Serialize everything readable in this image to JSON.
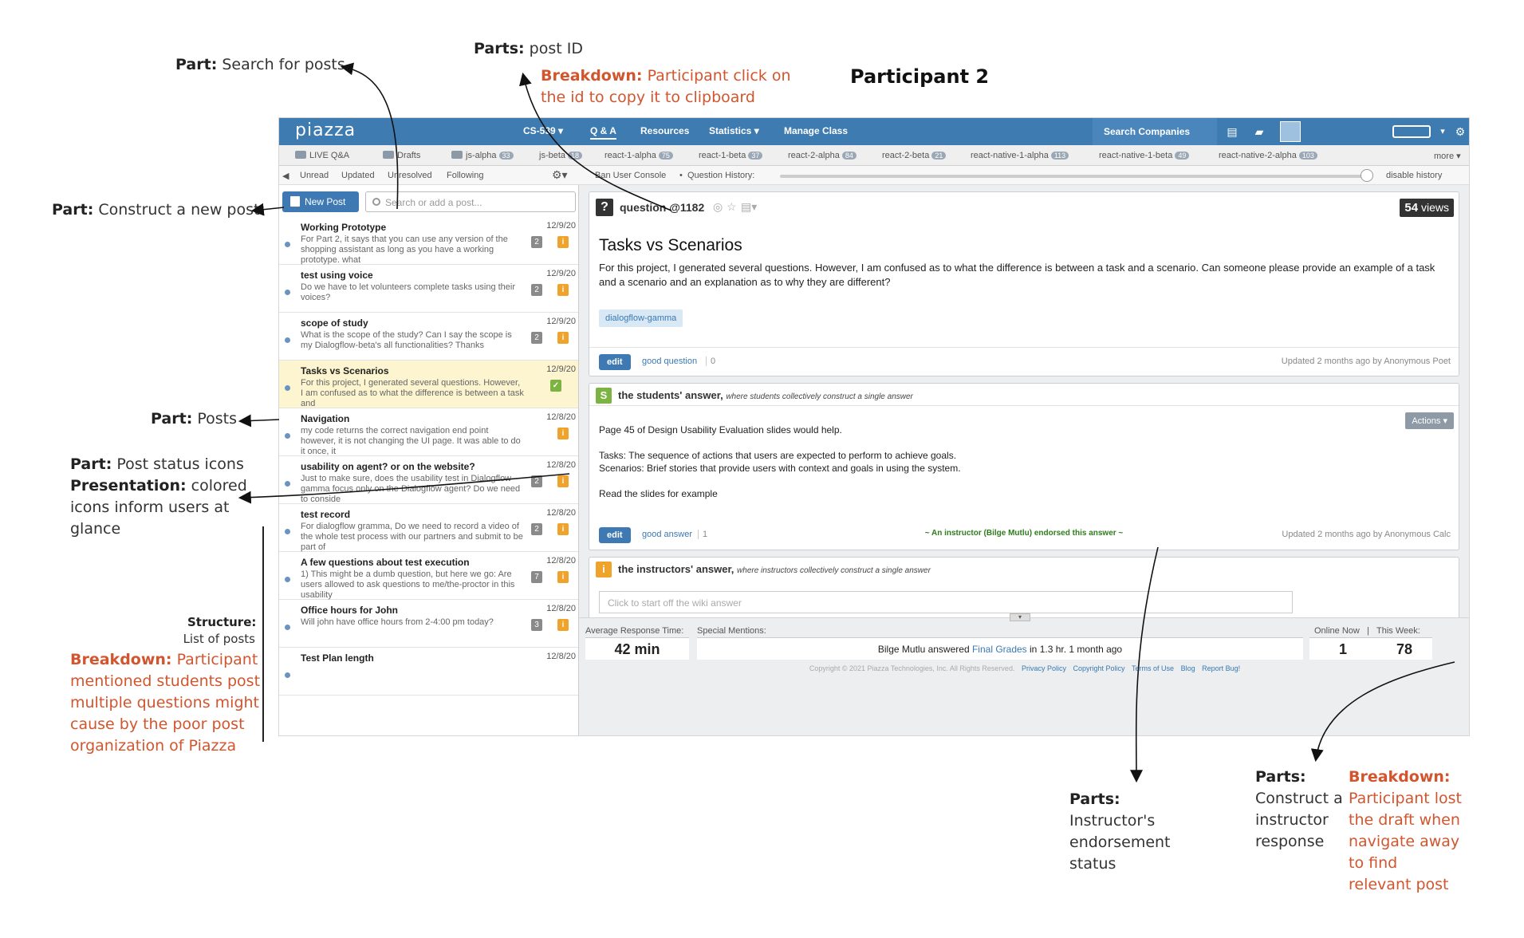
{
  "annotations": {
    "title": "Participant 2",
    "search": {
      "label": "Part:",
      "text": "Search for posts"
    },
    "post_id": {
      "label": "Parts:",
      "text": "post ID"
    },
    "post_id_breakdown": {
      "label": "Breakdown:",
      "text": "Participant click on",
      "text2": "the id to copy it to clipboard"
    },
    "new_post": {
      "label": "Part:",
      "text": "Construct a new post"
    },
    "posts": {
      "label": "Part:",
      "text": "Posts"
    },
    "status_icons": {
      "label": "Part:",
      "text": "Post status icons",
      "label2": "Presentation:",
      "text2": "colored",
      "lines": [
        "icons inform users at",
        "glance"
      ]
    },
    "structure": {
      "label": "Structure:",
      "text": "List of posts"
    },
    "structure_breakdown": {
      "label": "Breakdown:",
      "text": "Participant",
      "lines": [
        "mentioned students post",
        "multiple questions might",
        "cause by the poor post",
        "organization of Piazza"
      ]
    },
    "endorsement": {
      "label": "Parts:",
      "lines": [
        "Instructor's",
        "endorsement",
        "status"
      ]
    },
    "instructor_resp": {
      "label": "Parts:",
      "lines": [
        "Construct a",
        "instructor",
        "response"
      ]
    },
    "draft_breakdown": {
      "label": "Breakdown:",
      "lines": [
        "Participant lost",
        "the draft when",
        "navigate away",
        "to find",
        "relevant post"
      ]
    }
  },
  "topnav": {
    "logo": "piazza",
    "course": "CS-539 ▾",
    "qa": "Q & A",
    "resources": "Resources",
    "statistics": "Statistics ▾",
    "manage": "Manage Class",
    "search_companies": "Search Companies"
  },
  "folders": [
    {
      "name": "LIVE Q&A",
      "count": ""
    },
    {
      "name": "Drafts",
      "count": ""
    },
    {
      "name": "js-alpha",
      "count": "33"
    },
    {
      "name": "js-beta",
      "count": "18"
    },
    {
      "name": "react-1-alpha",
      "count": "75"
    },
    {
      "name": "react-1-beta",
      "count": "37"
    },
    {
      "name": "react-2-alpha",
      "count": "84"
    },
    {
      "name": "react-2-beta",
      "count": "21"
    },
    {
      "name": "react-native-1-alpha",
      "count": "113"
    },
    {
      "name": "react-native-1-beta",
      "count": "49"
    },
    {
      "name": "react-native-2-alpha",
      "count": "103"
    },
    {
      "name": "more ▾",
      "count": ""
    }
  ],
  "filters": {
    "unread": "Unread",
    "updated": "Updated",
    "unresolved": "Unresolved",
    "following": "Following",
    "ban": "Ban User Console",
    "history": "Question History:",
    "disable": "disable history"
  },
  "feed": {
    "new_post": "New Post",
    "search_placeholder": "Search or add a post...",
    "items": [
      {
        "title": "Working Prototype",
        "date": "12/9/20",
        "body": "For Part 2, it says that you can use any version of the shopping assistant as long as you have a working prototype. what",
        "count": "2",
        "badge": "i"
      },
      {
        "title": "test using voice",
        "date": "12/9/20",
        "body": "Do we have to let volunteers complete tasks using their voices?",
        "count": "2",
        "badge": "i"
      },
      {
        "title": "scope of study",
        "date": "12/9/20",
        "body": "What is the scope of the study? Can I say the scope is my Dialogflow-beta's all functionalities? Thanks",
        "count": "2",
        "badge": "i"
      },
      {
        "title": "Tasks vs Scenarios",
        "date": "12/9/20",
        "body": "For this project, I generated several questions. However, I am confused as to what the difference is between a task and",
        "count": "",
        "badge": "✓"
      },
      {
        "title": "Navigation",
        "date": "12/8/20",
        "body": "my code returns the correct navigation end point however, it is not changing the UI page. It was able to do it once, it",
        "count": "",
        "badge": "i"
      },
      {
        "title": "usability on agent? or on the website?",
        "date": "12/8/20",
        "body": "Just to make sure, does the usability test in Dialogflow gamma focus only on the Dialogflow agent? Do we need to conside",
        "count": "2",
        "badge": "i"
      },
      {
        "title": "test record",
        "date": "12/8/20",
        "body": "For dialogflow gramma, Do we need to record a video of the whole test process with our partners and submit to be part of",
        "count": "2",
        "badge": "i"
      },
      {
        "title": "A few questions about test execution",
        "date": "12/8/20",
        "body": "1) This might be a dumb question, but here we go: Are users allowed to ask questions to me/the-proctor in this usability",
        "count": "7",
        "badge": "i"
      },
      {
        "title": "Office hours for John",
        "date": "12/8/20",
        "body": "Will john have office hours from 2-4:00 pm today?",
        "count": "3",
        "badge": "i"
      },
      {
        "title": "Test Plan length",
        "date": "12/8/20",
        "body": "",
        "count": "",
        "badge": ""
      }
    ]
  },
  "question": {
    "id_label": "question @1182",
    "views_num": "54",
    "views_label": "views",
    "title": "Tasks vs Scenarios",
    "body": "For this project, I generated several questions. However, I am confused as to what the difference is between a task and a scenario. Can someone please provide an example of a task and a scenario and an explanation as to why they are different?",
    "tag": "dialogflow-gamma",
    "edit": "edit",
    "good": "good question",
    "good_count": "0",
    "updated": "Updated 2 months ago by Anonymous Poet"
  },
  "student_answer": {
    "icon": "S",
    "title": "the students' answer,",
    "subtitle": "where students collectively construct a single answer",
    "actions": "Actions ▾",
    "lines": [
      "Page 45 of Design Usability Evaluation slides would help.",
      "",
      "Tasks: The sequence of actions that users are expected to perform to achieve goals.",
      "Scenarios: Brief stories that provide users with context and goals in using the system.",
      "",
      "Read the slides for example"
    ],
    "endorsed": "~ An instructor (Bilge Mutlu) endorsed this answer ~",
    "edit": "edit",
    "good": "good answer",
    "good_count": "1",
    "updated": "Updated 2 months ago by Anonymous Calc"
  },
  "instructor_answer": {
    "icon": "i",
    "title": "the instructors' answer,",
    "subtitle": "where instructors collectively construct a single answer",
    "placeholder": "Click to start off the wiki answer"
  },
  "stats": {
    "avg_label": "Average Response Time:",
    "avg_value": "42 min",
    "mentions_label": "Special Mentions:",
    "mention_pre": "Bilge Mutlu answered",
    "mention_link": "Final Grades",
    "mention_post": "in 1.3 hr. 1 month ago",
    "online_label": "Online Now",
    "online_value": "1",
    "week_label": "This Week:",
    "week_value": "78",
    "copyright": "Copyright © 2021 Piazza Technologies, Inc. All Rights Reserved.",
    "links": [
      "Privacy Policy",
      "Copyright Policy",
      "Terms of Use",
      "Blog",
      "Report Bug!"
    ]
  }
}
